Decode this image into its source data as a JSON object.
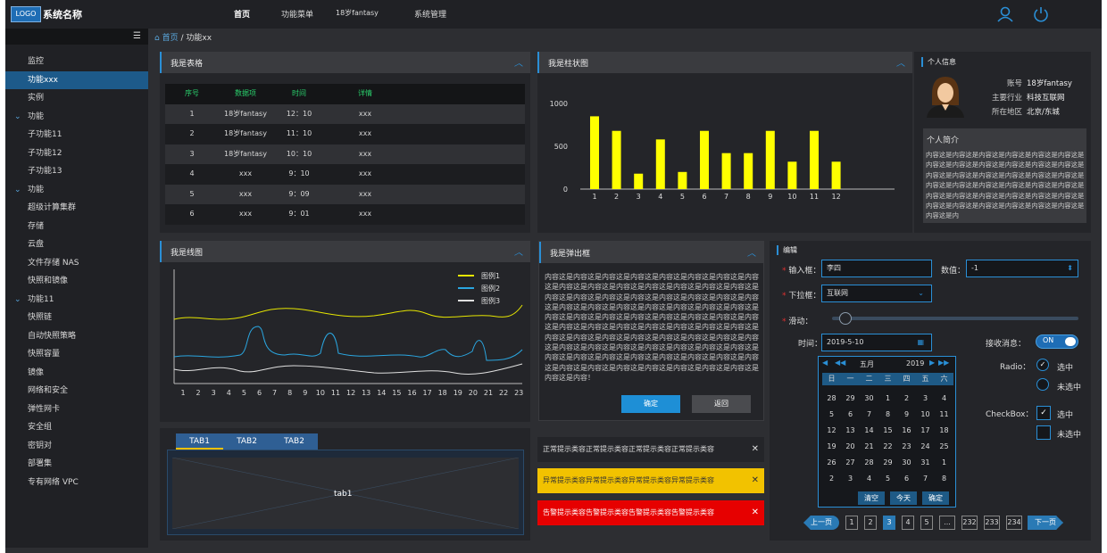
{
  "header": {
    "logo": "LOGO",
    "system_name": "系统名称",
    "nav": [
      "首页",
      "功能菜单",
      "18岁fantasy",
      "系统管理"
    ]
  },
  "sidebar": {
    "items": [
      {
        "label": "监控",
        "group": false
      },
      {
        "label": "功能xxx",
        "group": false,
        "active": true
      },
      {
        "label": "实例",
        "group": false
      },
      {
        "label": "功能",
        "group": true
      },
      {
        "label": "子功能11",
        "group": false
      },
      {
        "label": "子功能12",
        "group": false
      },
      {
        "label": "子功能13",
        "group": false
      },
      {
        "label": "功能",
        "group": true
      },
      {
        "label": "超级计算集群",
        "group": false
      },
      {
        "label": "存储",
        "group": false
      },
      {
        "label": "云盘",
        "group": false
      },
      {
        "label": "文件存储 NAS",
        "group": false
      },
      {
        "label": "快照和镜像",
        "group": false
      },
      {
        "label": "功能11",
        "group": true
      },
      {
        "label": "快照链",
        "group": false
      },
      {
        "label": "自动快照策略",
        "group": false
      },
      {
        "label": "快照容量",
        "group": false
      },
      {
        "label": "镜像",
        "group": false
      },
      {
        "label": "网络和安全",
        "group": false
      },
      {
        "label": "弹性网卡",
        "group": false
      },
      {
        "label": "安全组",
        "group": false
      },
      {
        "label": "密钥对",
        "group": false
      },
      {
        "label": "部署集",
        "group": false
      },
      {
        "label": "专有网络 VPC",
        "group": false
      }
    ]
  },
  "breadcrumb": {
    "home": "首页",
    "sep": "/",
    "current": "功能xx"
  },
  "table_panel": {
    "title": "我是表格",
    "headers": [
      "序号",
      "数据项",
      "时间",
      "详情"
    ],
    "rows": [
      [
        "1",
        "18岁fantasy",
        "12：10",
        "xxx"
      ],
      [
        "2",
        "18岁fantasy",
        "11：10",
        "xxx"
      ],
      [
        "3",
        "18岁fantasy",
        "10：10",
        "xxx"
      ],
      [
        "4",
        "xxx",
        "9：10",
        "xxx"
      ],
      [
        "5",
        "xxx",
        "9：09",
        "xxx"
      ],
      [
        "6",
        "xxx",
        "9：01",
        "xxx"
      ]
    ]
  },
  "bar_panel": {
    "title": "我是柱状图"
  },
  "chart_data": [
    {
      "type": "bar",
      "categories": [
        "1",
        "2",
        "3",
        "4",
        "5",
        "6",
        "7",
        "8",
        "9",
        "10",
        "11",
        "12"
      ],
      "values": [
        850,
        680,
        180,
        580,
        200,
        680,
        420,
        420,
        680,
        320,
        680,
        320
      ],
      "ylim": [
        0,
        1000
      ],
      "yticks": [
        "1000",
        "500",
        "0"
      ],
      "color": "#ffff00"
    },
    {
      "type": "line",
      "x": [
        "1",
        "2",
        "3",
        "4",
        "5",
        "6",
        "7",
        "8",
        "9",
        "10",
        "11",
        "12",
        "13",
        "14",
        "15",
        "16",
        "17",
        "18",
        "19",
        "20",
        "21",
        "22",
        "23"
      ],
      "legend": [
        "图例1",
        "图例2",
        "图例3"
      ],
      "colors": [
        "#e6e600",
        "#2aa6e0",
        "#e0e0e0"
      ]
    }
  ],
  "line_panel": {
    "title": "我是线图"
  },
  "profile": {
    "title": "个人信息",
    "fields": [
      {
        "k": "账号",
        "v": "18岁fantasy"
      },
      {
        "k": "主要行业",
        "v": "科技互联网"
      },
      {
        "k": "所在地区",
        "v": "北京/东城"
      }
    ],
    "intro_title": "个人简介",
    "intro": "内容这是内容这是内容这是内容这是内容这是内容这是内容这是内容这是内容这是内容这是内容这是内容这是内容这是内容这是内容这是内容这是内容这是内容这是内容这是内容这是内容这是内容这是内容这是内容这是内容这是内容这是内容这是内容这是内容这是内容这是内容这是内容这是内容这是内容这是内容这是内容这是内容这是内"
  },
  "dialog": {
    "title": "我是弹出框",
    "body": "内容这是内容这是内容这是内容这是内容这是内容这是内容这是内容这是内容这是内容这是内容这是内容这是内容这是内容这是内容这是内容这是内容这是内容这是内容这是内容这是内容这是内容这是内容这是内容这是内容这是内容这是内容这是内容这是内容这是内容这是内容这是内容这是内容这是内容这是内容这是内容这是内容这是内容这是内容这是内容这是内容这是内容这是内容这是内容这是内容这是内容这是内容这是内容这是内容这是内容这是内容这是内容这是内容这是内容这是内容这是内容这是内容这是内容这是内容这是内容这是内容这是内容这是内容这是内容这是内容这是内容这是内容这是内容这是内容这是内容这是内容这是内容这是内容这是内容这是内容这是内容这是内容！",
    "ok": "确定",
    "back": "返回"
  },
  "tabs": {
    "items": [
      "TAB1",
      "TAB2",
      "TAB2"
    ],
    "content": "tab1"
  },
  "alerts": [
    {
      "text": "正常提示类容正常提示类容正常提示类容正常提示类容",
      "bg": "#242529",
      "fg": "#ddd"
    },
    {
      "text": "异常提示类容异常提示类容异常提示类容异常提示类容",
      "bg": "#f2c200",
      "fg": "#333"
    },
    {
      "text": "告警提示类容告警提示类容告警提示类容告警提示类容",
      "bg": "#e60000",
      "fg": "#fff"
    }
  ],
  "form": {
    "title": "编辑",
    "input_label": "输入框：",
    "input_value": "李四",
    "num_label": "数值：",
    "num_value": "-1",
    "select_label": "下拉框：",
    "select_value": "互联网",
    "slider_label": "滑动：",
    "slider_value": 0.03,
    "date_label": "时间：",
    "date_value": "2019-5-10",
    "switch_label": "接收消息：",
    "switch_value": "ON",
    "radio_label": "Radio：",
    "radio_on": "选中",
    "radio_off": "未选中",
    "check_label": "CheckBox：",
    "check_on": "选中",
    "check_off": "未选中"
  },
  "calendar": {
    "month": "五月",
    "year": "2019",
    "weekdays": [
      "日",
      "一",
      "二",
      "三",
      "四",
      "五",
      "六"
    ],
    "rows": [
      [
        "28",
        "29",
        "30",
        "1",
        "2",
        "3",
        "4"
      ],
      [
        "5",
        "6",
        "7",
        "8",
        "9",
        "10",
        "11"
      ],
      [
        "12",
        "13",
        "14",
        "15",
        "16",
        "17",
        "18"
      ],
      [
        "19",
        "20",
        "21",
        "22",
        "23",
        "24",
        "25"
      ],
      [
        "26",
        "27",
        "28",
        "29",
        "30",
        "31",
        "1"
      ],
      [
        "2",
        "3",
        "4",
        "5",
        "6",
        "7",
        "8"
      ]
    ],
    "clear": "清空",
    "today": "今天",
    "ok": "确定"
  },
  "pagination": {
    "prev": "上一页",
    "pages": [
      "1",
      "2",
      "3",
      "4",
      "5",
      "...",
      "232",
      "233",
      "234"
    ],
    "active": "3",
    "next": "下一页"
  }
}
